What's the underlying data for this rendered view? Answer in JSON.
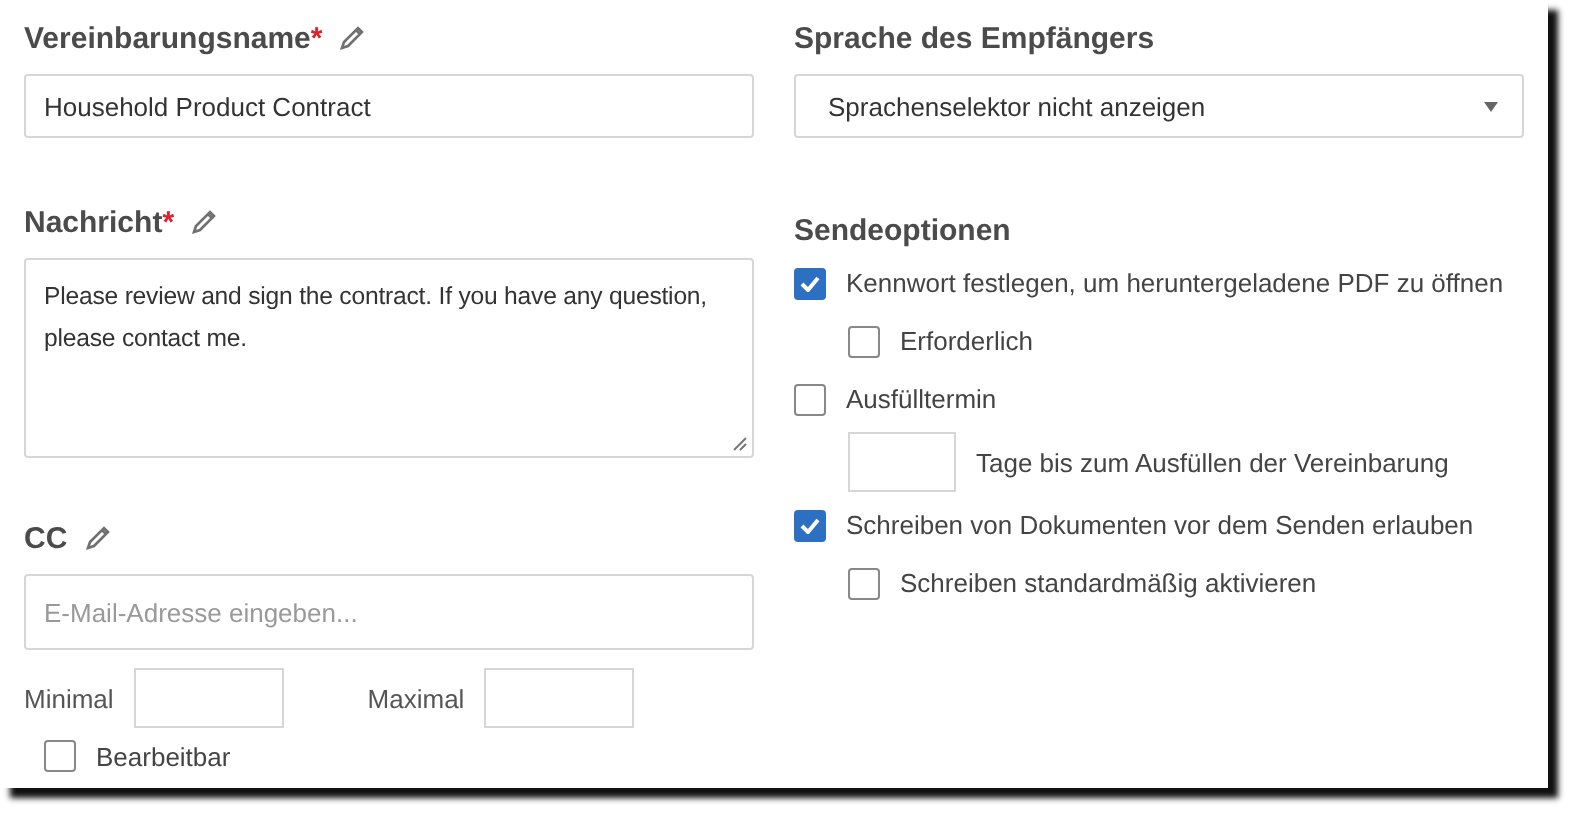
{
  "agreement_name": {
    "label": "Vereinbarungsname",
    "required_mark": "*",
    "value": "Household Product Contract"
  },
  "message": {
    "label": "Nachricht",
    "required_mark": "*",
    "value": "Please review and sign the contract. If you have any question, please contact me."
  },
  "cc": {
    "label": "CC",
    "placeholder": "E-Mail-Adresse eingeben...",
    "min_label": "Minimal",
    "max_label": "Maximal",
    "editable": {
      "label": "Bearbeitbar",
      "checked": false
    }
  },
  "recipient_language": {
    "label": "Sprache des Empfängers",
    "value": "Sprachenselektor nicht anzeigen"
  },
  "send_options": {
    "title": "Sendeoptionen",
    "items": [
      {
        "kind": "checkbox",
        "label": "Kennwort festlegen, um heruntergeladene PDF zu öffnen",
        "checked": true,
        "children": [
          {
            "kind": "checkbox",
            "label": "Erforderlich",
            "checked": false
          }
        ]
      },
      {
        "kind": "checkbox",
        "label": "Ausfülltermin",
        "checked": false,
        "children": [
          {
            "kind": "number",
            "label": "Tage bis zum Ausfüllen der Vereinbarung"
          }
        ]
      },
      {
        "kind": "checkbox",
        "label": "Schreiben von Dokumenten vor dem Senden erlauben",
        "checked": true,
        "children": [
          {
            "kind": "checkbox",
            "label": "Schreiben standardmäßig aktivieren",
            "checked": false
          }
        ]
      }
    ]
  }
}
